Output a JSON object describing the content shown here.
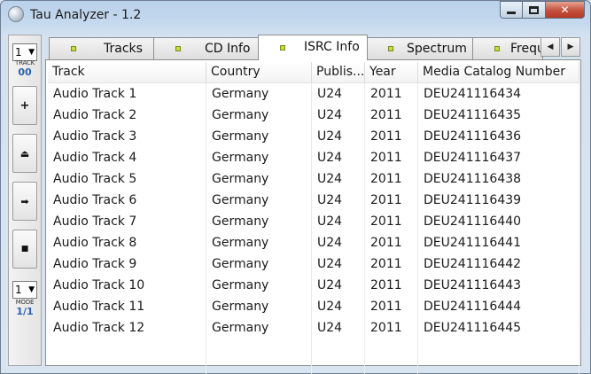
{
  "window": {
    "title": "Tau Analyzer - 1.2",
    "close_glyph": "✕"
  },
  "toolbar": {
    "track_select_value": "1",
    "track_caption": "TRACK",
    "track_value": "00",
    "plus_glyph": "+",
    "eject_glyph": "⏏",
    "play_glyph": "➡",
    "stop_glyph": "■",
    "mode_select_value": "1",
    "mode_caption": "MODE",
    "mode_value": "1/1",
    "dropdown_glyph": "▼"
  },
  "tabs": [
    {
      "label": "Tracks",
      "active": false
    },
    {
      "label": "CD Info",
      "active": false
    },
    {
      "label": "ISRC Info",
      "active": true
    },
    {
      "label": "Spectrum",
      "active": false
    },
    {
      "label": "Frequ",
      "active": false
    }
  ],
  "tab_scroll": {
    "left": "◀",
    "right": "▶"
  },
  "table": {
    "columns": [
      "Track",
      "Country",
      "Publis...",
      "Year",
      "Media Catalog Number"
    ],
    "rows": [
      [
        "Audio Track 1",
        "Germany",
        "U24",
        "2011",
        "DEU241116434"
      ],
      [
        "Audio Track 2",
        "Germany",
        "U24",
        "2011",
        "DEU241116435"
      ],
      [
        "Audio Track 3",
        "Germany",
        "U24",
        "2011",
        "DEU241116436"
      ],
      [
        "Audio Track 4",
        "Germany",
        "U24",
        "2011",
        "DEU241116437"
      ],
      [
        "Audio Track 5",
        "Germany",
        "U24",
        "2011",
        "DEU241116438"
      ],
      [
        "Audio Track 6",
        "Germany",
        "U24",
        "2011",
        "DEU241116439"
      ],
      [
        "Audio Track 7",
        "Germany",
        "U24",
        "2011",
        "DEU241116440"
      ],
      [
        "Audio Track 8",
        "Germany",
        "U24",
        "2011",
        "DEU241116441"
      ],
      [
        "Audio Track 9",
        "Germany",
        "U24",
        "2011",
        "DEU241116442"
      ],
      [
        "Audio Track 10",
        "Germany",
        "U24",
        "2011",
        "DEU241116443"
      ],
      [
        "Audio Track 11",
        "Germany",
        "U24",
        "2011",
        "DEU241116444"
      ],
      [
        "Audio Track 12",
        "Germany",
        "U24",
        "2011",
        "DEU241116445"
      ]
    ]
  },
  "colors": {
    "accent_blue": "#2a62b0",
    "tab_dot": "#c8dc3c",
    "close_red": "#c4513b"
  }
}
